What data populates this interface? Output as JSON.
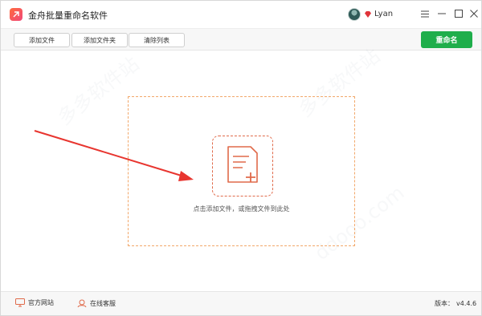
{
  "app": {
    "title": "金舟批量重命名软件",
    "logo_icon": "app-logo-icon"
  },
  "user": {
    "name": "Lyan",
    "vip_icon": "diamond-icon"
  },
  "window_controls": {
    "menu_icon": "menu-icon",
    "minimize_icon": "minimize-icon",
    "maximize_icon": "maximize-icon",
    "close_icon": "close-icon"
  },
  "toolbar": {
    "add_file_label": "添加文件",
    "add_folder_label": "添加文件夹",
    "clear_list_label": "清除列表",
    "rename_label": "重命名",
    "rename_color": "#1fae4b"
  },
  "main": {
    "drop_hint": "点击添加文件，或拖拽文件到此处",
    "add_icon": "add-file-icon",
    "accent_color": "#e06a4a"
  },
  "statusbar": {
    "website_label": "官方网站",
    "service_label": "在线客服",
    "version_label": "版本：",
    "version_value": "v4.4.6"
  }
}
